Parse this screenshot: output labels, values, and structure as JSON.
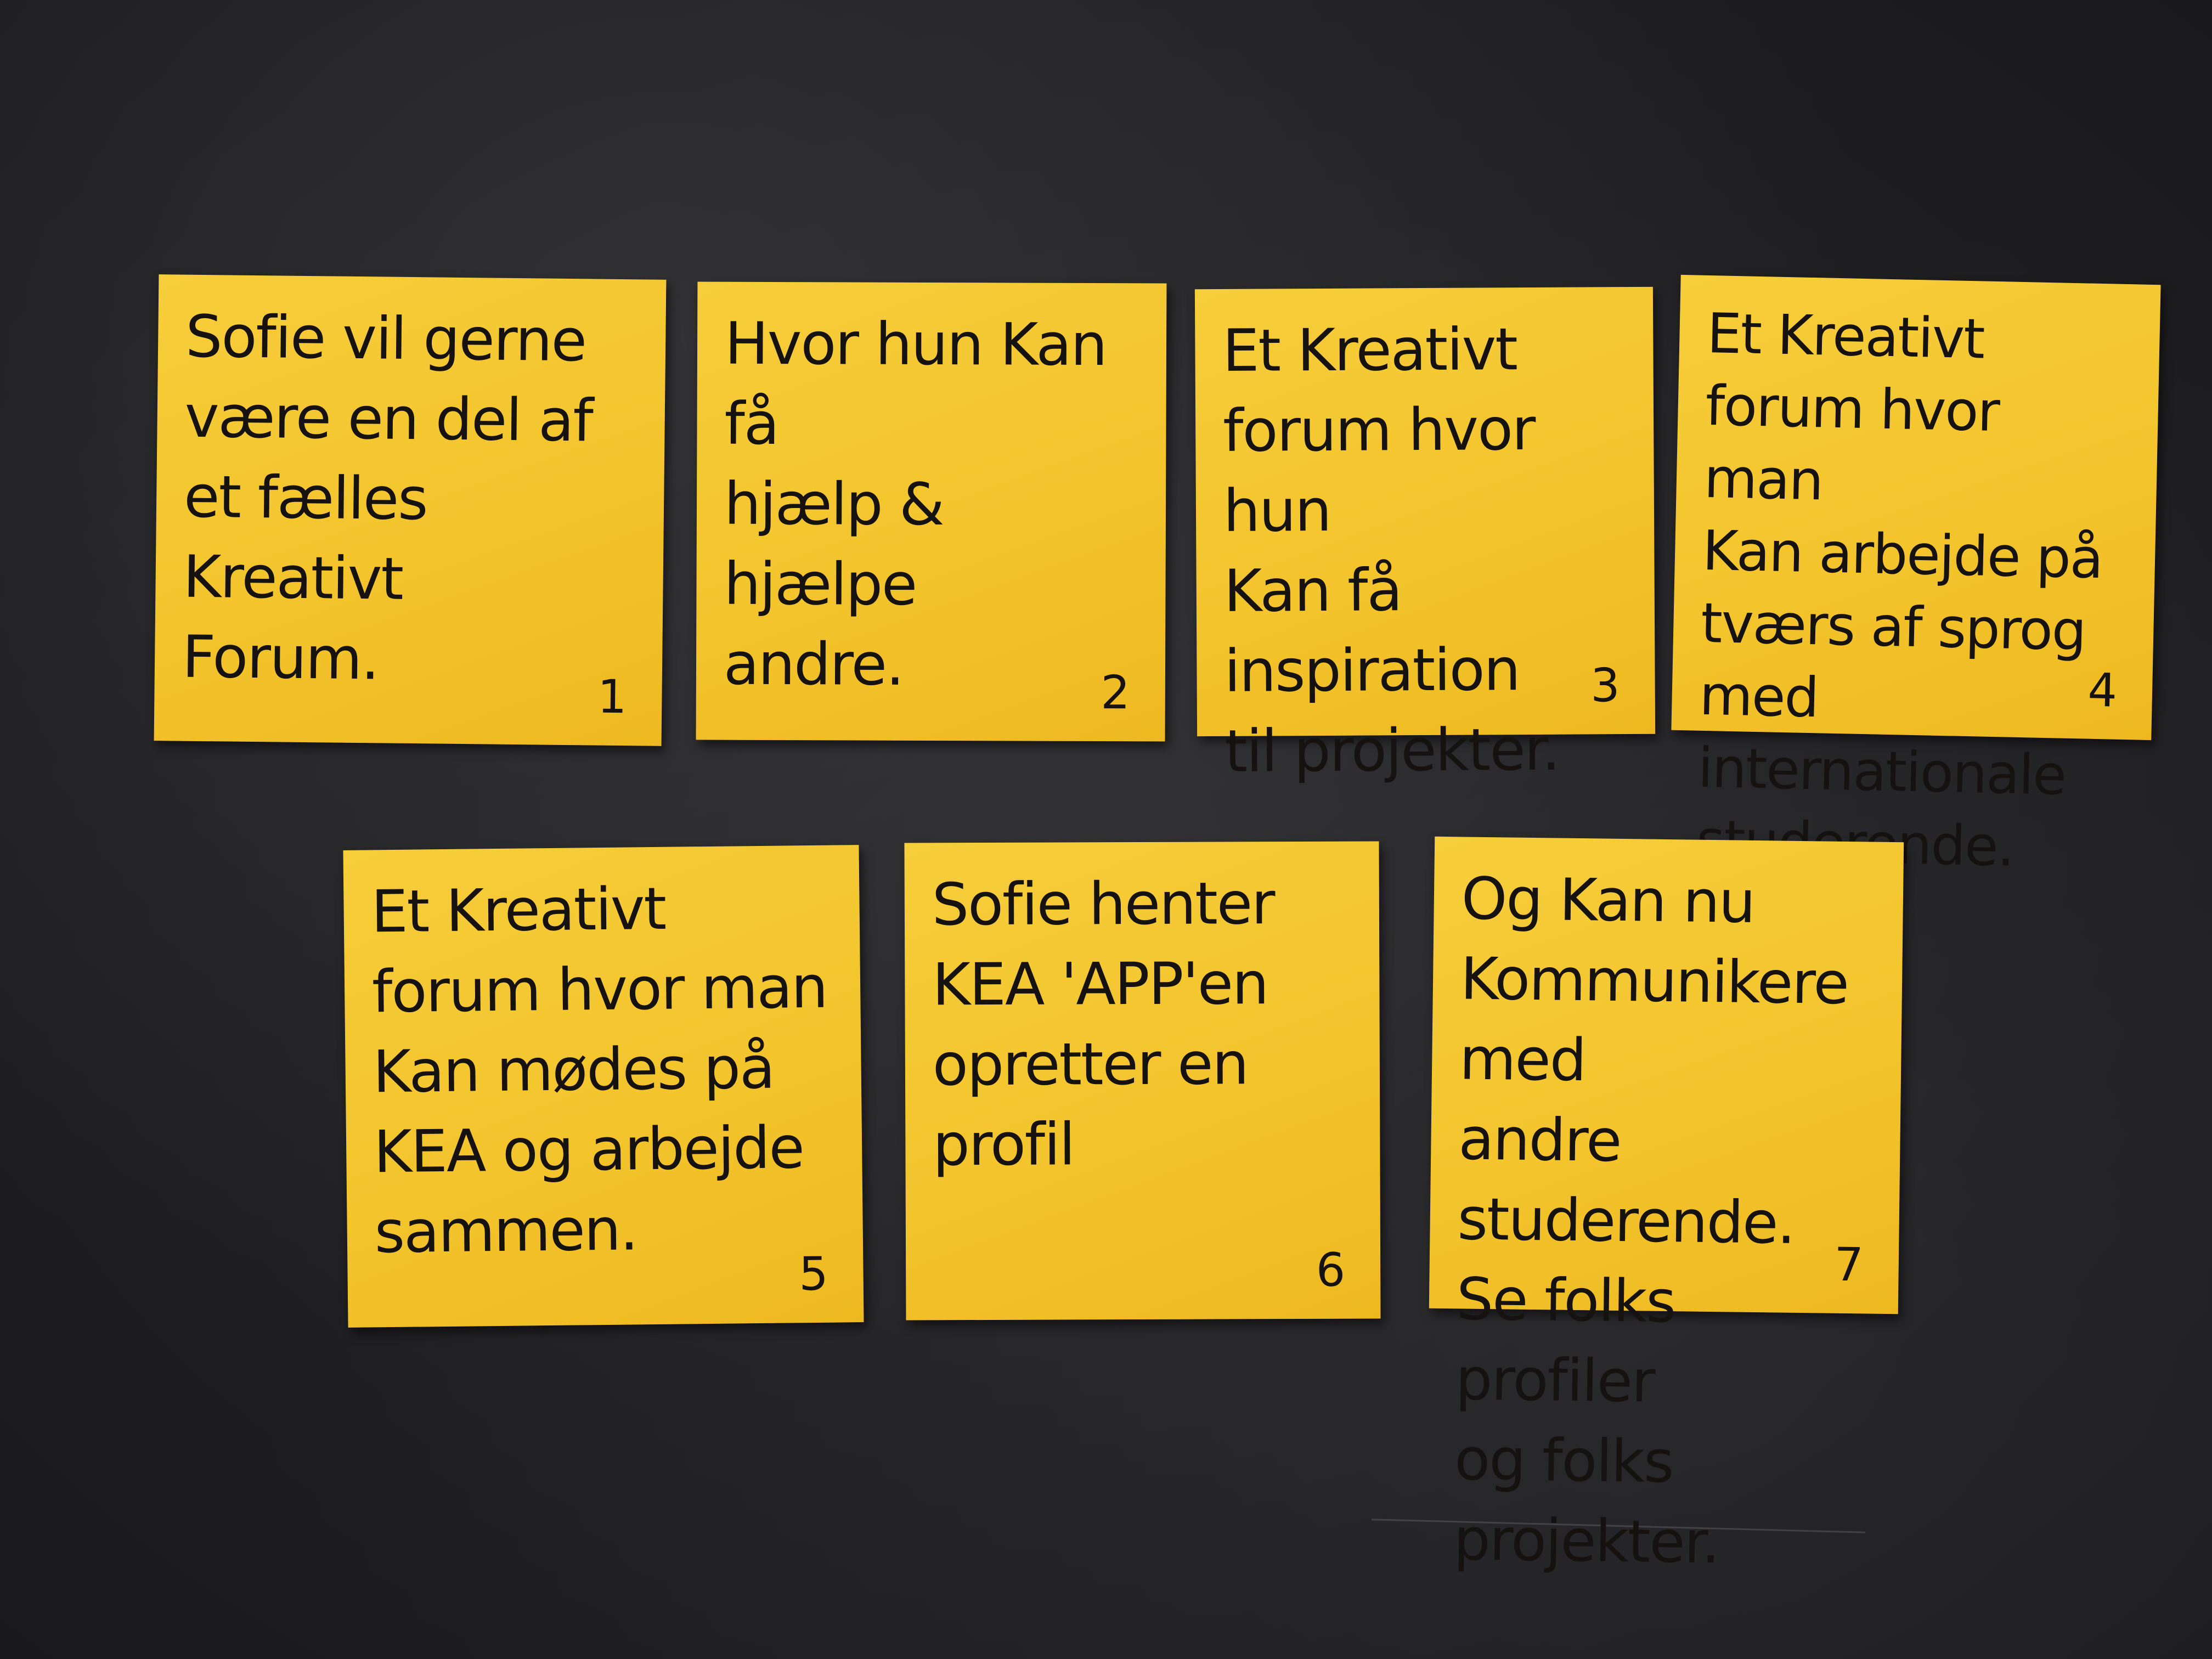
{
  "notes": [
    {
      "text": "Sofie vil gerne\nvære en del af\net fælles Kreativt\nForum.",
      "number": "1"
    },
    {
      "text": "Hvor hun Kan få\nhjælp & hjælpe\nandre.",
      "number": "2"
    },
    {
      "text": "Et Kreativt\nforum hvor hun\nKan få inspiration\ntil projekter.",
      "number": "3"
    },
    {
      "text": "Et Kreativt\nforum hvor man\nKan arbejde på\ntværs af sprog\nmed internationale\nstuderende.",
      "number": "4"
    },
    {
      "text": "Et Kreativt\nforum hvor man\nKan mødes på\nKEA og arbejde\nsammen.",
      "number": "5"
    },
    {
      "text": "Sofie henter\nKEA 'APP'en\nopretter en profil",
      "number": "6"
    },
    {
      "text": "Og Kan nu\nKommunikere med\nandre studerende.\nSe folks profiler\nog folks projekter.",
      "number": "7"
    }
  ],
  "colors": {
    "note_yellow": "#f3c42c",
    "board_dark": "#1f1f21",
    "ink": "#151210"
  }
}
